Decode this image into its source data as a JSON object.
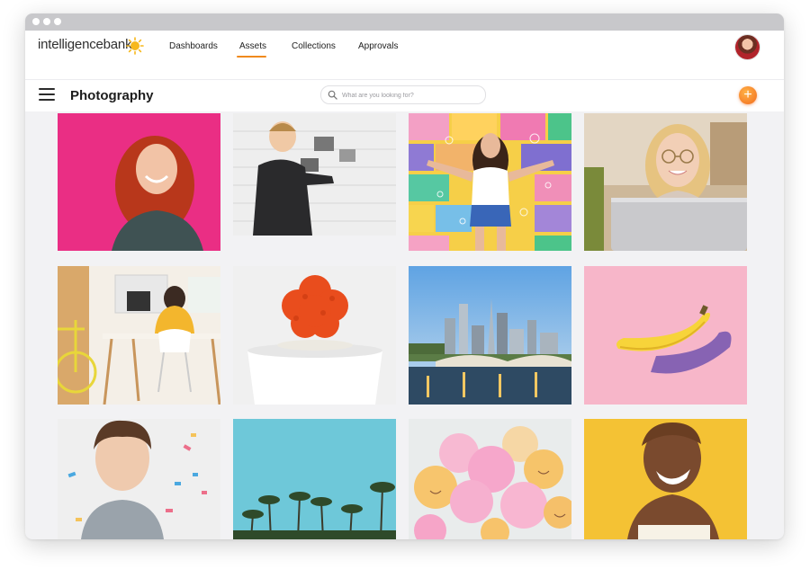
{
  "brand": {
    "logo_text": "intelligencebank",
    "accent_color": "#f08a1d"
  },
  "nav": {
    "items": [
      {
        "label": "Dashboards"
      },
      {
        "label": "Assets",
        "active": true
      },
      {
        "label": "Collections"
      },
      {
        "label": "Approvals"
      }
    ]
  },
  "page": {
    "title": "Photography"
  },
  "search": {
    "placeholder": "What are you looking for?"
  },
  "add_button": {
    "label": "+"
  },
  "assets": [
    {
      "subject": "smiling red-haired woman on pink background"
    },
    {
      "subject": "man pinning photos to a white brick wall"
    },
    {
      "subject": "woman with bubbles in front of colorful brick wall"
    },
    {
      "subject": "smiling woman with glasses at laptop"
    },
    {
      "subject": "woman at desk with bicycle in home office"
    },
    {
      "subject": "orange cactus in white pot"
    },
    {
      "subject": "city skyline with bridge over river"
    },
    {
      "subject": "banana on pink background"
    },
    {
      "subject": "young man with confetti"
    },
    {
      "subject": "palm trees against blue sky"
    },
    {
      "subject": "pastel balloons with smiley faces"
    },
    {
      "subject": "laughing woman on yellow background"
    }
  ]
}
